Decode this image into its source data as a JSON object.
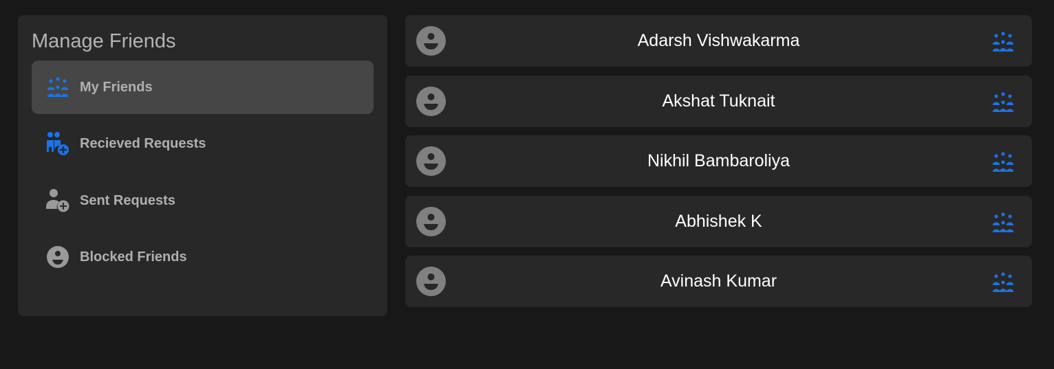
{
  "sidebar": {
    "title": "Manage Friends",
    "items": [
      {
        "label": "My Friends",
        "icon": "friends-group-icon",
        "active": true
      },
      {
        "label": "Recieved Requests",
        "icon": "received-requests-icon",
        "active": false
      },
      {
        "label": "Sent Requests",
        "icon": "sent-requests-icon",
        "active": false
      },
      {
        "label": "Blocked Friends",
        "icon": "blocked-user-icon",
        "active": false
      }
    ]
  },
  "friends": [
    {
      "name": "Adarsh Vishwakarma"
    },
    {
      "name": "Akshat Tuknait"
    },
    {
      "name": "Nikhil Bambaroliya"
    },
    {
      "name": "Abhishek K"
    },
    {
      "name": "Avinash Kumar"
    }
  ],
  "colors": {
    "accent": "#1a73e8",
    "background": "#181818",
    "panel": "#282828",
    "active_item": "#464646",
    "avatar_gray": "#808080"
  }
}
